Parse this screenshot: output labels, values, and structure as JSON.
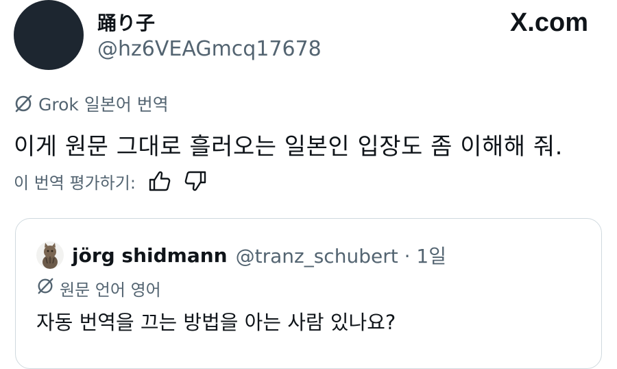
{
  "site": {
    "logo_text": "X.com"
  },
  "author": {
    "display_name": "踊り子",
    "handle": "@hz6VEAGmcq17678"
  },
  "translation": {
    "label": "Grok 일본어 번역",
    "text": "이게 원문 그대로 흘러오는 일본인 입장도 좀 이해해 줘.",
    "rate_prompt": "이 번역 평가하기:",
    "icons": [
      "grok-slash-icon",
      "thumbs-up-icon",
      "thumbs-down-icon"
    ]
  },
  "quote": {
    "display_name": "jörg shidmann",
    "meta": "@tranz_schubert · 1일",
    "lang_label": "원문 언어 영어",
    "text": "자동 번역을 끄는 방법을 아는 사람 있나요?",
    "avatar_icon": "cat-avatar-icon"
  },
  "colors": {
    "text_primary": "#0f1419",
    "text_secondary": "#536471",
    "border": "#cfd9de",
    "avatar_dark": "#1d2630"
  }
}
